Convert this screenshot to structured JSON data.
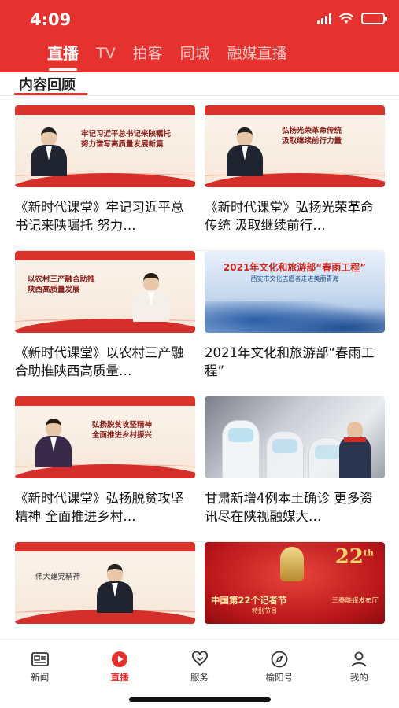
{
  "status_bar": {
    "time": "4:09"
  },
  "top_tabs": [
    {
      "label": "直播",
      "active": true
    },
    {
      "label": "TV",
      "active": false
    },
    {
      "label": "拍客",
      "active": false
    },
    {
      "label": "同城",
      "active": false
    },
    {
      "label": "融媒直播",
      "active": false
    }
  ],
  "section_title": "内容回顾",
  "cards": [
    {
      "caption": "《新时代课堂》牢记习近平总书记来陕嘱托 努力…",
      "thumb_text": "牢记习近平总书记来陕嘱托\n努力谱写高质量发展新篇"
    },
    {
      "caption": "《新时代课堂》弘扬光荣革命传统 汲取继续前行…",
      "thumb_text": "弘扬光荣革命传统\n汲取继续前行力量"
    },
    {
      "caption": "《新时代课堂》以农村三产融合助推陕西高质量…",
      "thumb_text": "以农村三产融合助推\n陕西高质量发展"
    },
    {
      "caption": "2021年文化和旅游部“春雨工程”",
      "thumb_title": "2021年文化和旅游部“春雨工程”",
      "thumb_sub": "西安市文化志愿者走进美丽青海"
    },
    {
      "caption": "《新时代课堂》弘扬脱贫攻坚精神 全面推进乡村…",
      "thumb_text": "弘扬脱贫攻坚精神\n全面推进乡村振兴"
    },
    {
      "caption": "甘肃新增4例本土确诊 更多资讯尽在陕视融媒大…"
    },
    {
      "caption": "",
      "thumb_text": "伟大建党精神"
    },
    {
      "caption": "",
      "thumb_title": "中国第22个记者节",
      "thumb_big": "22",
      "thumb_big_suffix": "th",
      "thumb_right": "三秦融媒发布厅",
      "thumb_sub": "特别节目"
    }
  ],
  "bottom_nav": [
    {
      "label": "新闻",
      "icon": "news-icon",
      "active": false
    },
    {
      "label": "直播",
      "icon": "live-play-icon",
      "active": true
    },
    {
      "label": "服务",
      "icon": "service-heart-icon",
      "active": false
    },
    {
      "label": "榆阳号",
      "icon": "compass-icon",
      "active": false
    },
    {
      "label": "我的",
      "icon": "profile-icon",
      "active": false
    }
  ],
  "colors": {
    "brand_red": "#e5322f",
    "battery_green": "#4cd964"
  }
}
